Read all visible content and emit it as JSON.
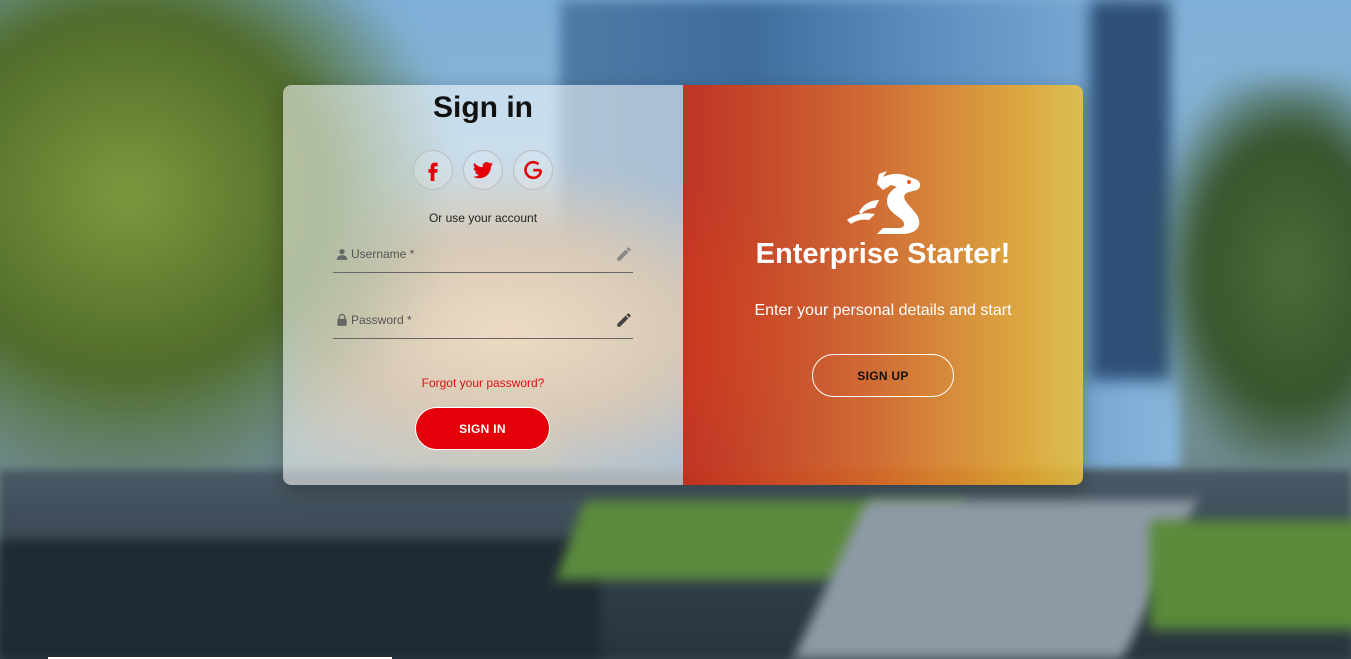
{
  "signin": {
    "title": "Sign in",
    "social_icons": [
      "facebook-icon",
      "twitter-icon",
      "google-icon"
    ],
    "or_text": "Or use your account",
    "username_placeholder": "Username *",
    "password_placeholder": "Password *",
    "forgot_label": "Forgot your password?",
    "button_label": "SIGN IN"
  },
  "promo": {
    "brand": "Enterprise Starter!",
    "tagline": "Enter your personal details and start",
    "button_label": "SIGN UP",
    "logo_icon": "dragon-logo-icon"
  },
  "colors": {
    "accent_red": "#e30008",
    "link_red": "#d11111",
    "gradient_start": "#cd2d19",
    "gradient_end": "#ebc33c"
  }
}
